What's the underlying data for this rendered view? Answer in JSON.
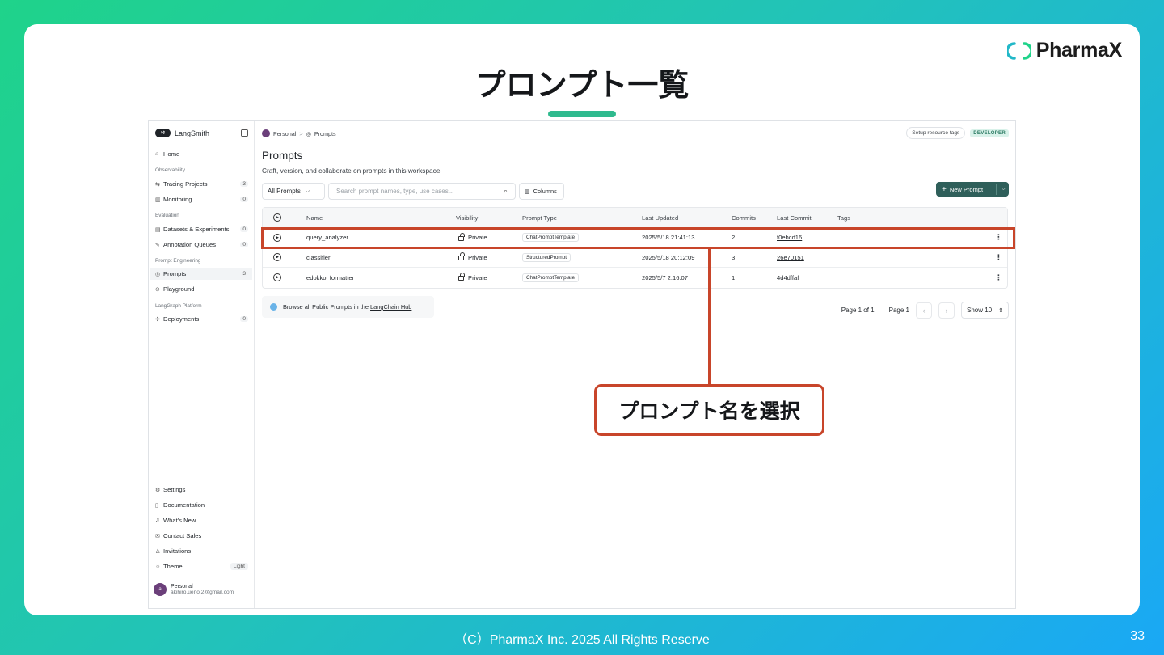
{
  "slide": {
    "title": "プロンプト一覧",
    "logo_text": "PharmaX",
    "footer": "（C）PharmaX Inc. 2025  All Rights Reserve",
    "page_number": "33",
    "callout": "プロンプト名を選択",
    "colors": {
      "accent": "#2fba8e",
      "highlight": "#c8452a"
    }
  },
  "sidebar": {
    "brand": "LangSmith",
    "home": "Home",
    "sections": {
      "observability": "Observability",
      "evaluation": "Evaluation",
      "prompt_engineering": "Prompt Engineering",
      "langgraph": "LangGraph Platform"
    },
    "items": {
      "tracing": {
        "label": "Tracing Projects",
        "count": "3"
      },
      "monitoring": {
        "label": "Monitoring",
        "count": "0"
      },
      "datasets": {
        "label": "Datasets & Experiments",
        "count": "0"
      },
      "annotation": {
        "label": "Annotation Queues",
        "count": "0"
      },
      "prompts": {
        "label": "Prompts",
        "count": "3"
      },
      "playground": {
        "label": "Playground"
      },
      "deployments": {
        "label": "Deployments",
        "count": "0"
      }
    },
    "bottom": {
      "settings": "Settings",
      "documentation": "Documentation",
      "whats_new": "What's New",
      "contact": "Contact Sales",
      "invitations": "Invitations",
      "theme": "Theme",
      "theme_value": "Light"
    },
    "user": {
      "name": "Personal",
      "email": "akihiro.ueno.2@gmail.com"
    }
  },
  "header": {
    "breadcrumb_personal": "Personal",
    "breadcrumb_sep": ">",
    "breadcrumb_prompts": "Prompts",
    "setup_tags": "Setup resource tags",
    "badge": "DEVELOPER"
  },
  "page": {
    "title": "Prompts",
    "subtitle": "Craft, version, and collaborate on prompts in this workspace.",
    "filter": "All Prompts",
    "search_placeholder": "Search prompt names, type, use cases...",
    "columns_btn": "Columns",
    "new_prompt": "New Prompt"
  },
  "table": {
    "headers": [
      "Name",
      "Visibility",
      "Prompt Type",
      "Last Updated",
      "Commits",
      "Last Commit",
      "Tags"
    ],
    "rows": [
      {
        "name": "query_analyzer",
        "visibility": "Private",
        "type": "ChatPromptTemplate",
        "updated": "2025/5/18 21:41:13",
        "commits": "2",
        "commit": "f0ebcd16"
      },
      {
        "name": "classifier",
        "visibility": "Private",
        "type": "StructuredPrompt",
        "updated": "2025/5/18 20:12:09",
        "commits": "3",
        "commit": "26e70151"
      },
      {
        "name": "edokko_formatter",
        "visibility": "Private",
        "type": "ChatPromptTemplate",
        "updated": "2025/5/7 2:16:07",
        "commits": "1",
        "commit": "4d4dffaf"
      }
    ]
  },
  "hub": {
    "text": "Browse all Public Prompts in the ",
    "link": "LangChain Hub"
  },
  "pager": {
    "summary": "Page 1 of 1",
    "page": "Page 1",
    "show": "Show 10"
  }
}
